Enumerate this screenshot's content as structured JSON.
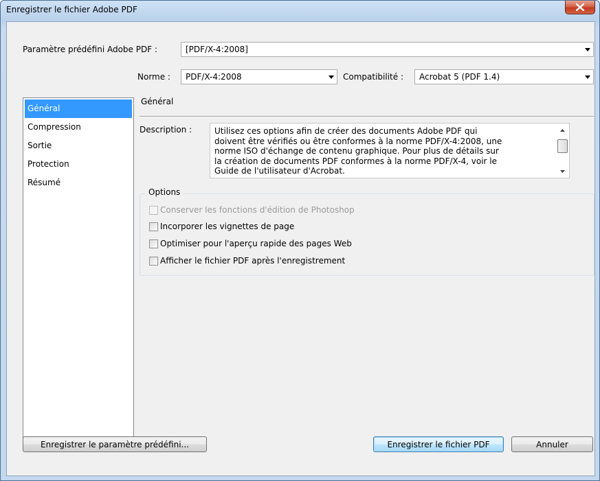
{
  "window": {
    "title": "Enregistrer le fichier Adobe PDF",
    "close_icon": "close-icon"
  },
  "preset": {
    "label": "Paramètre prédéfini Adobe PDF :",
    "value": "[PDF/X-4:2008]"
  },
  "standard": {
    "label": "Norme :",
    "value": "PDF/X-4:2008"
  },
  "compatibility": {
    "label": "Compatibilité :",
    "value": "Acrobat 5 (PDF 1.4)"
  },
  "sidebar": {
    "items": [
      {
        "label": "Général",
        "selected": true
      },
      {
        "label": "Compression",
        "selected": false
      },
      {
        "label": "Sortie",
        "selected": false
      },
      {
        "label": "Protection",
        "selected": false
      },
      {
        "label": "Résumé",
        "selected": false
      }
    ]
  },
  "main": {
    "section_title": "Général",
    "description_label": "Description :",
    "description_lines": [
      "Utilisez ces options afin de créer des documents Adobe PDF qui",
      "doivent être vérifiés ou être conformes à la norme PDF/X-4:2008, une",
      "norme ISO d'échange de contenu graphique. Pour plus de détails sur",
      "la création de documents PDF conformes à la norme PDF/X-4, voir le",
      "Guide de l'utilisateur d'Acrobat."
    ],
    "options_label": "Options",
    "options": [
      {
        "label": "Conserver les fonctions d'édition de Photoshop",
        "checked": false,
        "enabled": false
      },
      {
        "label": "Incorporer les vignettes de page",
        "checked": false,
        "enabled": true
      },
      {
        "label": "Optimiser pour l'aperçu rapide des pages Web",
        "checked": false,
        "enabled": true
      },
      {
        "label": "Afficher le fichier PDF après l'enregistrement",
        "checked": false,
        "enabled": true
      }
    ]
  },
  "buttons": {
    "save_preset": "Enregistrer le paramètre prédéfini...",
    "save_pdf": "Enregistrer le fichier PDF",
    "cancel": "Annuler"
  },
  "colors": {
    "selection": "#3399ff",
    "dialog_bg": "#f0f0f0",
    "disabled_text": "#9a9a9a"
  }
}
